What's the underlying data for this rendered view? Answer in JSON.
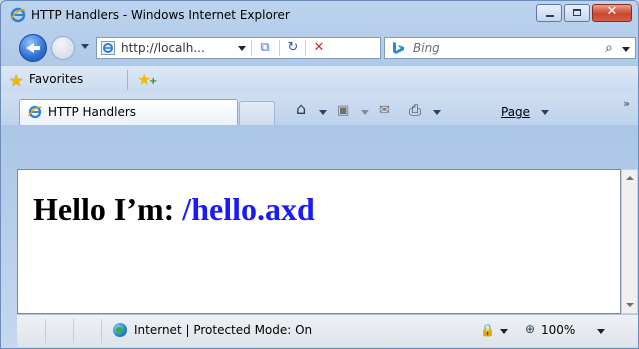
{
  "window": {
    "title": "HTTP Handlers - Windows Internet Explorer",
    "close_glyph": "✕"
  },
  "navigation": {
    "address": "http://localh...",
    "search_placeholder": "Bing",
    "search_glyph": "⌕",
    "refresh_glyph": "↻",
    "stop_glyph": "✕",
    "compat_glyph": "⧉"
  },
  "favorites_bar": {
    "label": "Favorites",
    "star_glyph": "★",
    "plus_glyph": "+"
  },
  "tabs": [
    {
      "label": "HTTP Handlers"
    }
  ],
  "command_bar": {
    "home_glyph": "⌂",
    "feeds_glyph": "▣",
    "mail_glyph": "✉",
    "print_glyph": "⎙",
    "page_label": "Page",
    "chevron": "»"
  },
  "page": {
    "heading_prefix": "Hello I’m: ",
    "heading_path": "/hello.axd"
  },
  "status_bar": {
    "zone_text": "Internet | Protected Mode: On",
    "lock_glyph": "🔒",
    "zoom_glyph": "⊕",
    "zoom_level": "100%"
  },
  "colors": {
    "heading_path": "#1a1aff",
    "close_button": "#c9472f"
  }
}
